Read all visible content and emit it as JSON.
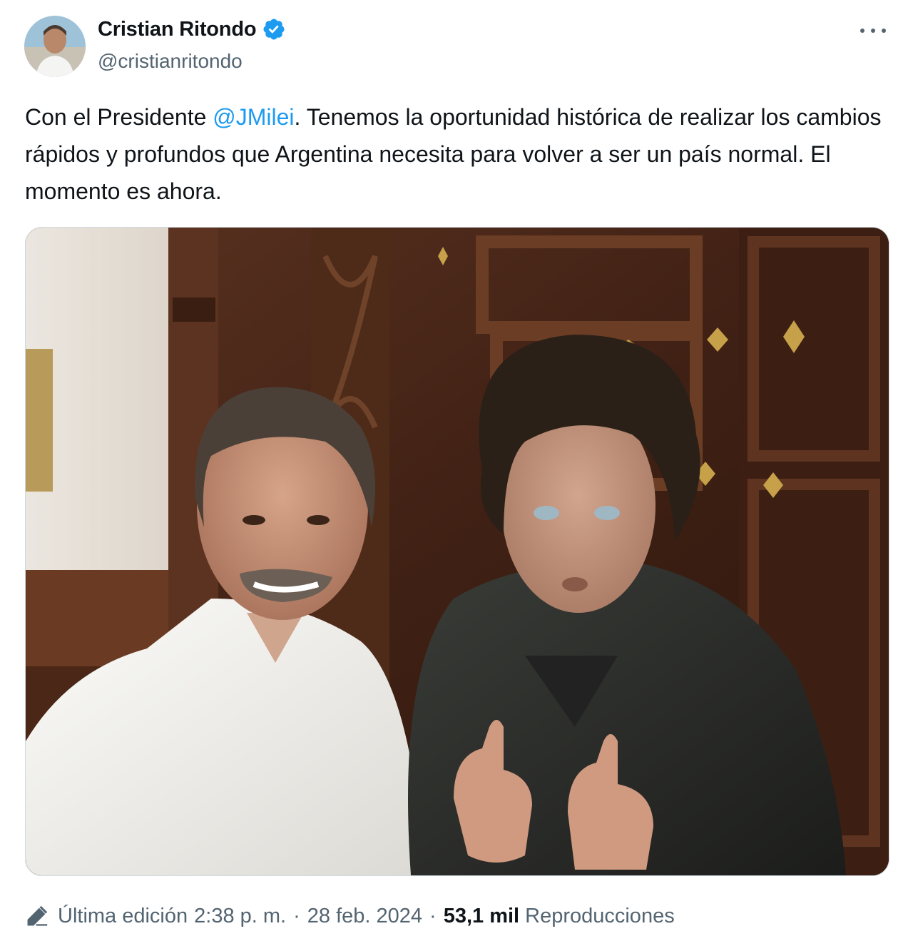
{
  "author": {
    "name": "Cristian Ritondo",
    "handle": "@cristianritondo",
    "verified_icon": "verified-badge-icon",
    "verified_color": "#1d9bf0"
  },
  "menu": {
    "icon": "more-icon"
  },
  "tweet": {
    "text_before": "Con el Presidente ",
    "mention": "@JMilei",
    "text_after": ". Tenemos la oportunidad histórica de realizar los cambios rápidos y profundos que Argentina necesita para volver a ser un país normal. El momento es ahora."
  },
  "media": {
    "type": "photo",
    "subject": "selfie"
  },
  "footer": {
    "edit_icon": "pencil-icon",
    "edit_label": "Última edición",
    "time": "2:38 p. m.",
    "separator": "·",
    "date": "28 feb. 2024",
    "views_count": "53,1 mil",
    "views_label": "Reproducciones"
  },
  "colors": {
    "text": "#0f1419",
    "secondary": "#536471",
    "link": "#1d9bf0"
  }
}
